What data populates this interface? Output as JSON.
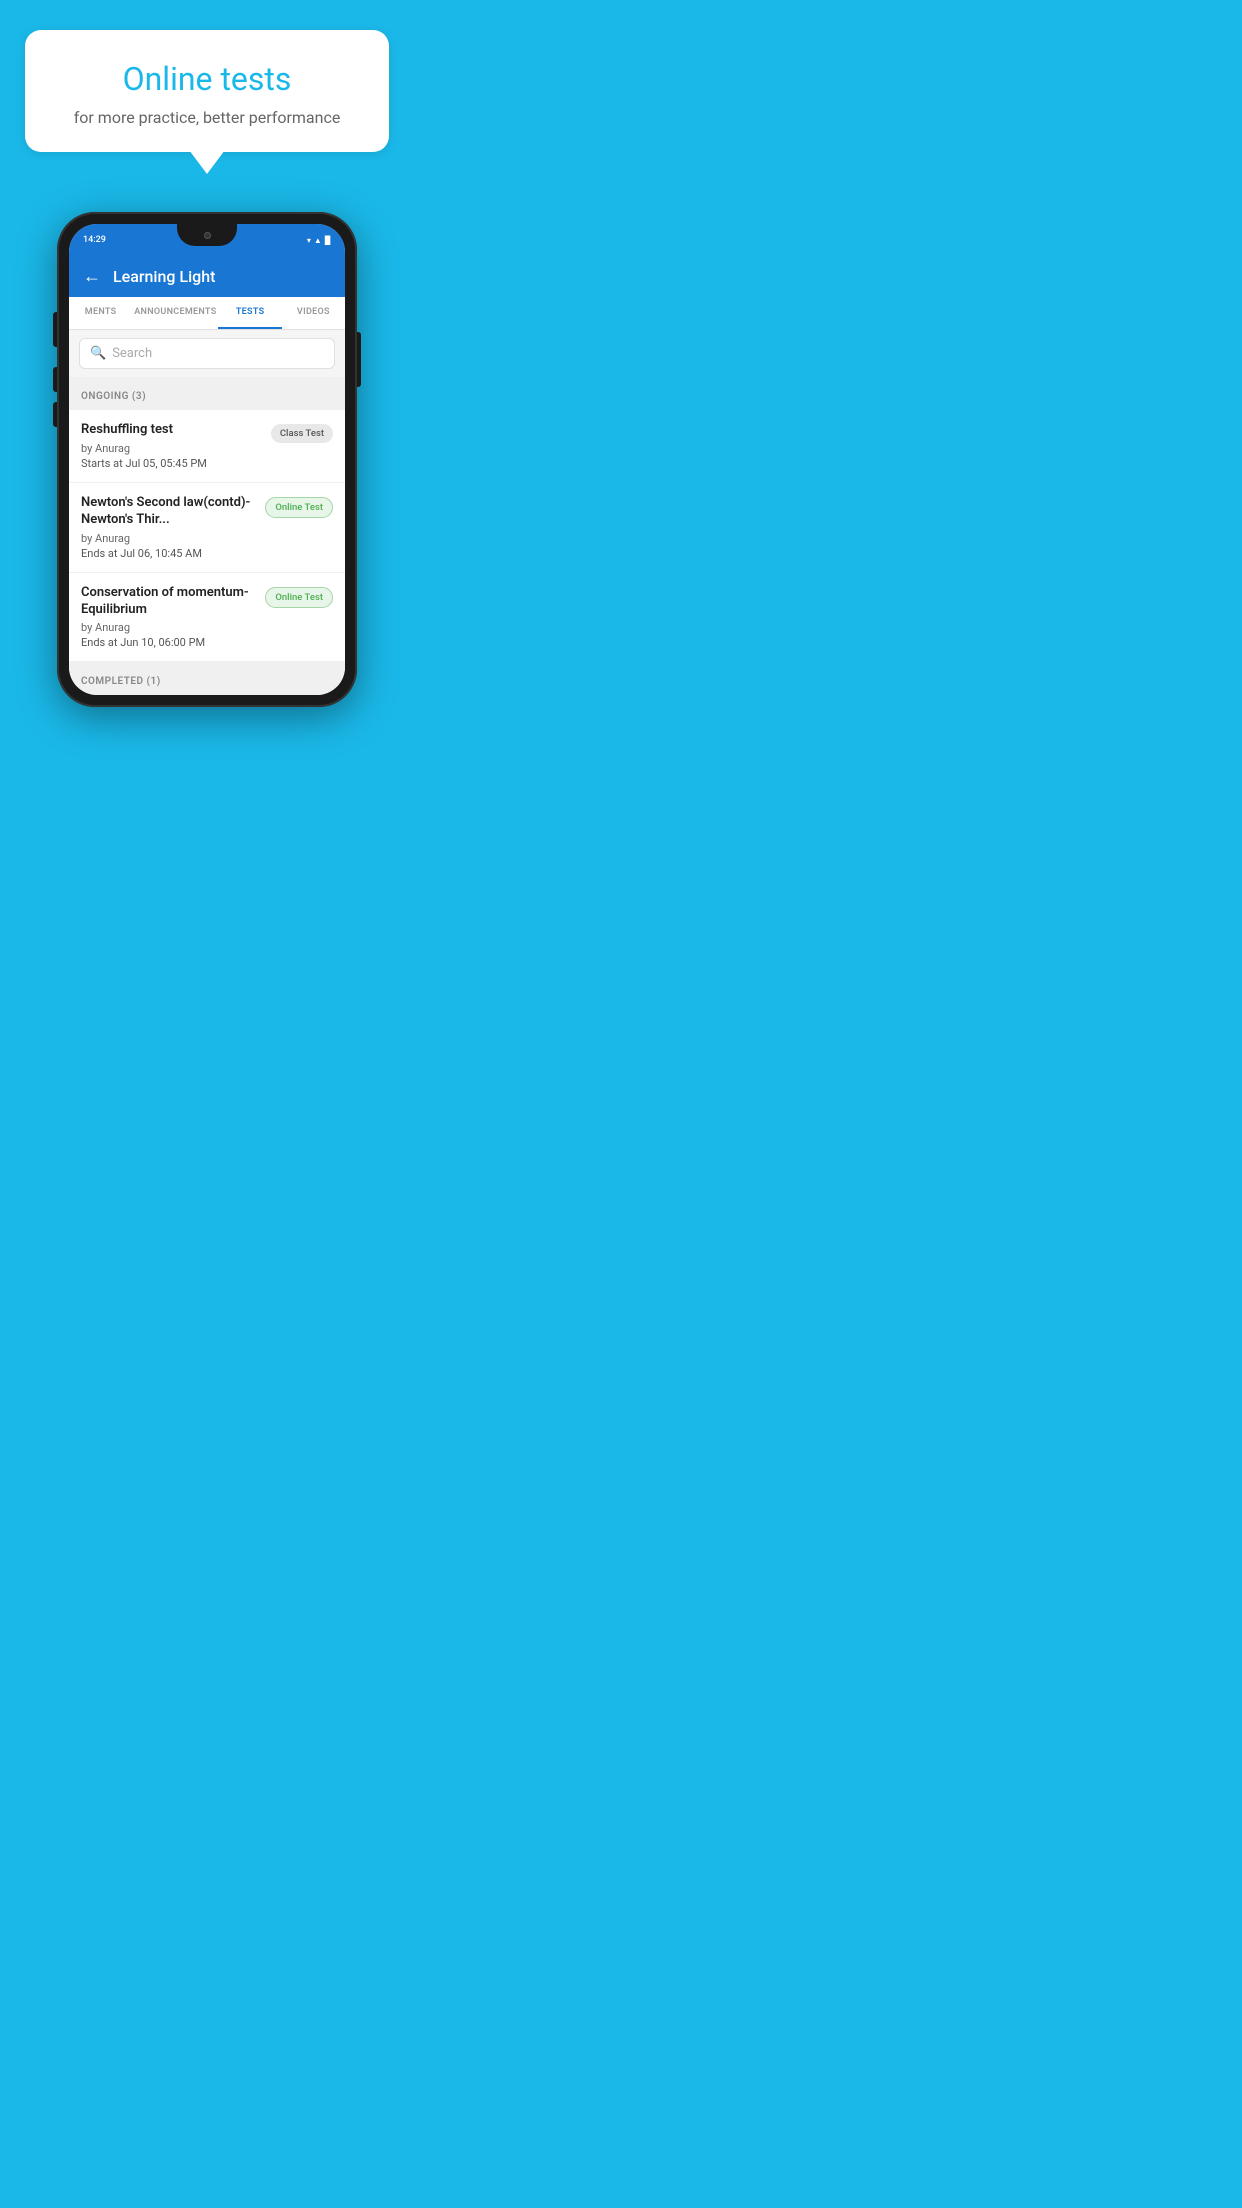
{
  "background": {
    "color": "#1ab8e8"
  },
  "speech_bubble": {
    "title": "Online tests",
    "subtitle": "for more practice, better performance"
  },
  "phone": {
    "status_bar": {
      "time": "14:29",
      "icons": [
        "wifi",
        "signal",
        "battery"
      ]
    },
    "app_header": {
      "back_label": "←",
      "title": "Learning Light"
    },
    "tabs": [
      {
        "label": "MENTS",
        "active": false
      },
      {
        "label": "ANNOUNCEMENTS",
        "active": false
      },
      {
        "label": "TESTS",
        "active": true
      },
      {
        "label": "VIDEOS",
        "active": false
      }
    ],
    "search": {
      "placeholder": "Search",
      "icon": "🔍"
    },
    "sections": [
      {
        "header": "ONGOING (3)",
        "items": [
          {
            "name": "Reshuffling test",
            "author": "by Anurag",
            "time_label": "Starts at",
            "time_value": "Jul 05, 05:45 PM",
            "badge": "Class Test",
            "badge_type": "class"
          },
          {
            "name": "Newton's Second law(contd)-Newton's Thir...",
            "author": "by Anurag",
            "time_label": "Ends at",
            "time_value": "Jul 06, 10:45 AM",
            "badge": "Online Test",
            "badge_type": "online"
          },
          {
            "name": "Conservation of momentum-Equilibrium",
            "author": "by Anurag",
            "time_label": "Ends at",
            "time_value": "Jun 10, 06:00 PM",
            "badge": "Online Test",
            "badge_type": "online"
          }
        ]
      },
      {
        "header": "COMPLETED (1)",
        "items": []
      }
    ]
  }
}
